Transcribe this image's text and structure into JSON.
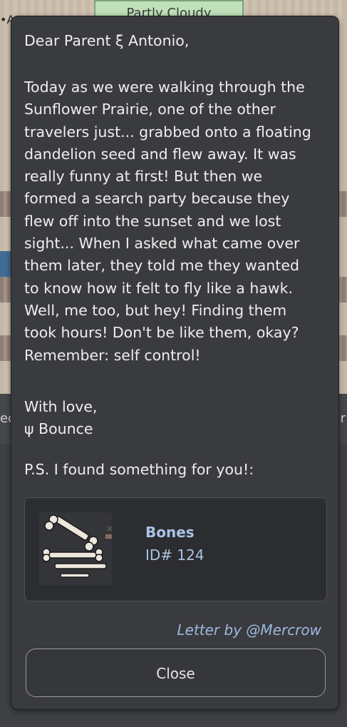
{
  "background": {
    "weather_label": "Partly Cloudy",
    "left_fragment": "•Ant",
    "bar_left_fragment": "ec",
    "bar_right_fragment": "r"
  },
  "letter": {
    "greeting": "Dear Parent ξ Antonio,",
    "body_lines": [
      "Today as we were walking through the",
      "Sunflower Prairie, one of the other",
      "travelers just... grabbed onto a floating",
      "dandelion seed and flew away. It was",
      "really funny at first! But then we",
      "formed a search party because they",
      "flew off into the sunset and we lost",
      "sight... When I asked what came over",
      "them later, they told me they wanted",
      "to know how it felt to fly like a hawk.",
      "Well, me too, but hey! Finding them",
      "took hours! Don't be like them, okay?",
      "Remember: self control!"
    ],
    "closing": "With love,",
    "signature": "ψ Bounce",
    "ps": "P.S. I found something for you!:"
  },
  "item": {
    "name": "Bones",
    "id": "ID# 124",
    "icon": "bones-icon"
  },
  "credit": "Letter by @Mercrow",
  "close_label": "Close",
  "colors": {
    "modal_bg": "#3a3b3e",
    "text": "#eeeeee",
    "item_text": "#aac3e6",
    "credit": "#9db8df"
  }
}
